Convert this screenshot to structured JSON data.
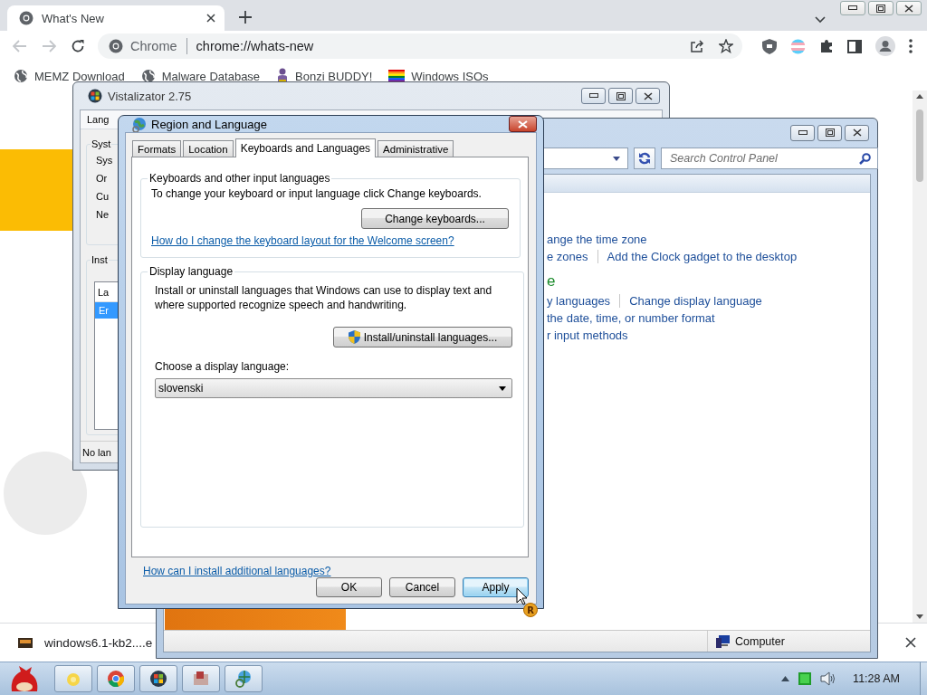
{
  "browser": {
    "tabs": [
      {
        "title": "What's New",
        "selected": true
      }
    ],
    "omnibox": {
      "site": "Chrome",
      "url": "chrome://whats-new"
    },
    "bookmarks": [
      {
        "label": "MEMZ Download",
        "kind": "globe"
      },
      {
        "label": "Malware Database",
        "kind": "globe"
      },
      {
        "label": "Bonzi BUDDY!",
        "kind": "figure"
      },
      {
        "label": "Windows ISOs",
        "kind": "flag"
      }
    ]
  },
  "vistalizator": {
    "title": "Vistalizator 2.75",
    "menu": [
      "Lang"
    ],
    "system_group": {
      "legend": "Syst",
      "items": [
        "Sys",
        "Or",
        "Cu",
        "Ne"
      ]
    },
    "installed_group": {
      "legend": "Inst",
      "list_header": "La",
      "rows": [
        {
          "text": "Er",
          "selected": true
        }
      ]
    },
    "status": "No lan"
  },
  "control_panel": {
    "search": {
      "placeholder": "Search Control Panel"
    },
    "sections": [
      {
        "rows": [
          [
            "ange the time zone"
          ],
          [
            "e zones",
            "Add the Clock gadget to the desktop"
          ]
        ]
      },
      {
        "heading": "e",
        "rows": [
          [
            "y languages",
            "Change display language"
          ],
          [
            "the date, time, or number format"
          ],
          [
            "r input methods"
          ]
        ]
      }
    ],
    "status": "Computer"
  },
  "dialog": {
    "title": "Region and Language",
    "tabs": [
      {
        "label": "Formats",
        "selected": false
      },
      {
        "label": "Location",
        "selected": false
      },
      {
        "label": "Keyboards and Languages",
        "selected": true
      },
      {
        "label": "Administrative",
        "selected": false
      }
    ],
    "keyboards_group": {
      "legend": "Keyboards and other input languages",
      "text": "To change your keyboard or input language click Change keyboards.",
      "button": "Change keyboards...",
      "link": "How do I change the keyboard layout for the Welcome screen?"
    },
    "display_group": {
      "legend": "Display language",
      "text": "Install or uninstall languages that Windows can use to display text and where supported recognize speech and handwriting.",
      "button": "Install/uninstall languages...",
      "select_label": "Choose a display language:",
      "select_value": "slovenski"
    },
    "link": "How can I install additional languages?",
    "buttons": [
      {
        "label": "OK",
        "default": false
      },
      {
        "label": "Cancel",
        "default": false
      },
      {
        "label": "Apply",
        "default": true
      }
    ],
    "cursor_badge": "R"
  },
  "downloads": [
    {
      "file": "windows6.1-kb2....e"
    }
  ],
  "taskbar": {
    "clock": "11:28 AM"
  }
}
